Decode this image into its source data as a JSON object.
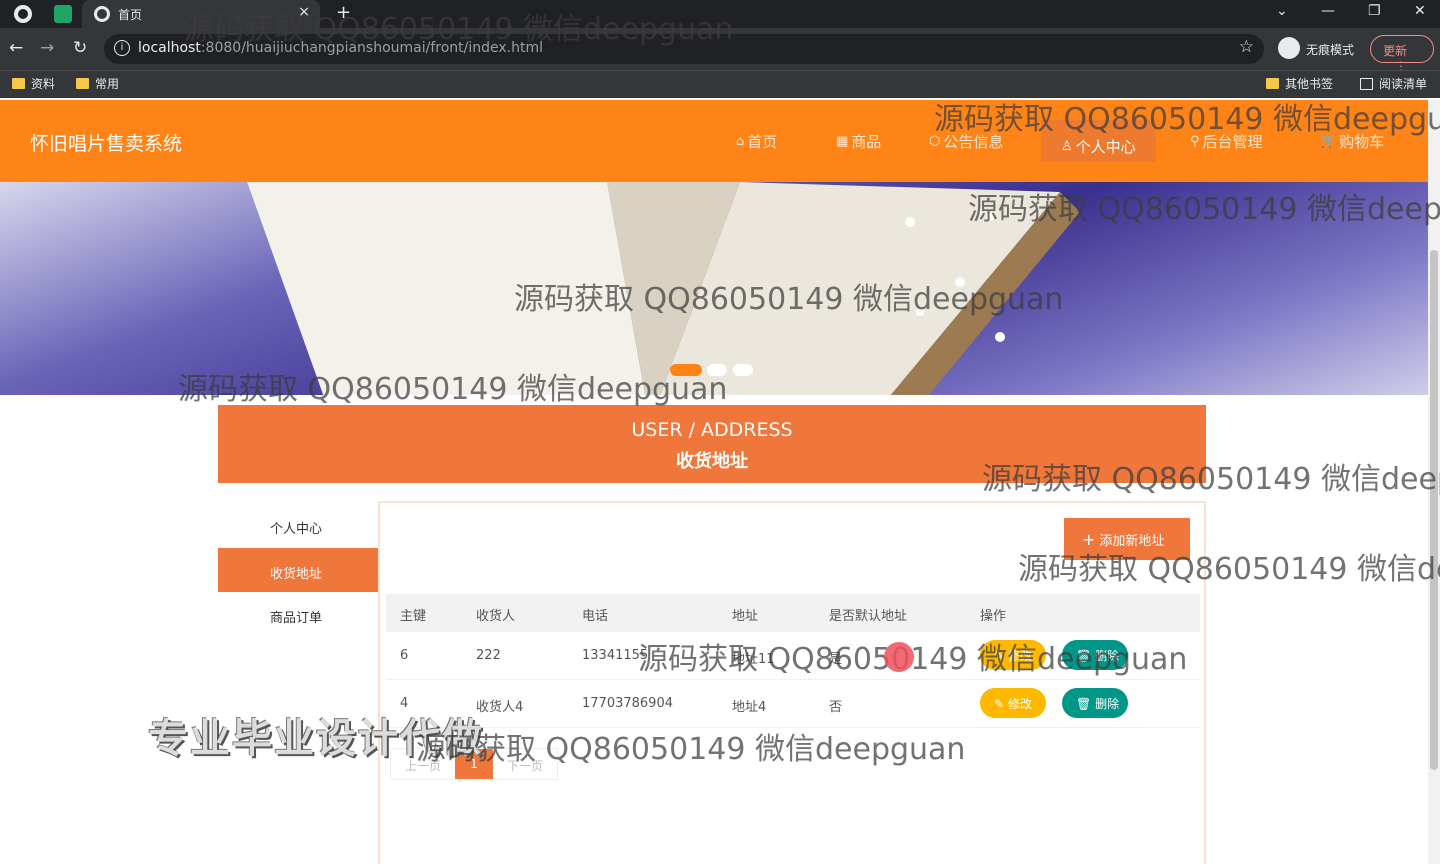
{
  "browser": {
    "tab_title": "首页",
    "tab_close": "×",
    "new_tab": "+",
    "url_host": "localhost",
    "url_rest": ":8080/huaijiuchangpianshoumai/front/index.html",
    "incognito_label": "无痕模式",
    "update_label": "更新",
    "update_menu": "⋮",
    "bookmarks": [
      "资料",
      "常用"
    ],
    "other_bookmarks": "其他书签",
    "reading_list": "阅读清单",
    "nav_back": "←",
    "nav_forward": "→",
    "nav_reload": "↻",
    "star": "☆",
    "win_dropdown": "⌄",
    "win_min": "—",
    "win_restore": "❐",
    "win_close": "✕"
  },
  "site": {
    "title": "怀旧唱片售卖系统",
    "nav": [
      {
        "icon": "⌂",
        "label": "首页"
      },
      {
        "icon": "▦",
        "label": "商品"
      },
      {
        "icon": "⬡",
        "label": "公告信息"
      },
      {
        "icon": "♙",
        "label": "个人中心"
      },
      {
        "icon": "⚲",
        "label": "后台管理"
      },
      {
        "icon": "🛒",
        "label": "购物车"
      }
    ],
    "active_nav": "个人中心"
  },
  "banner": {
    "slide_count": 3,
    "active_slide": 1
  },
  "section": {
    "title_en": "USER / ADDRESS",
    "title_cn": "收货地址"
  },
  "menu": {
    "items": [
      "个人中心",
      "收货地址",
      "商品订单"
    ],
    "active": "收货地址"
  },
  "actions": {
    "add_address": "添加新地址",
    "add_icon": "+"
  },
  "table": {
    "columns": [
      "主键",
      "收货人",
      "电话",
      "地址",
      "是否默认地址",
      "操作"
    ],
    "rows": [
      {
        "id": "6",
        "receiver": "222",
        "phone": "13341155",
        "address": "地址11",
        "default": "是",
        "edit": "修改",
        "delete": "删除"
      },
      {
        "id": "4",
        "receiver": "收货人4",
        "phone": "17703786904",
        "address": "地址4",
        "default": "否",
        "edit": "修改",
        "delete": "删除"
      }
    ]
  },
  "pagination": {
    "prev": "上一页",
    "current": "1",
    "next": "下一页"
  },
  "overlays": {
    "watermark": "源码获取 QQ86050149 微信deepguan",
    "watermark_cut_1": "源码获取 QQ86050149 微信deepgua",
    "watermark_cut_2": "源码获取 QQ86050149 微信deepg",
    "watermark_cut_3": "源码获取 QQ86050149 微信deep",
    "watermark_cut_4": "源码获取 QQ86050149 微信de",
    "promo": "专业毕业设计代做"
  }
}
